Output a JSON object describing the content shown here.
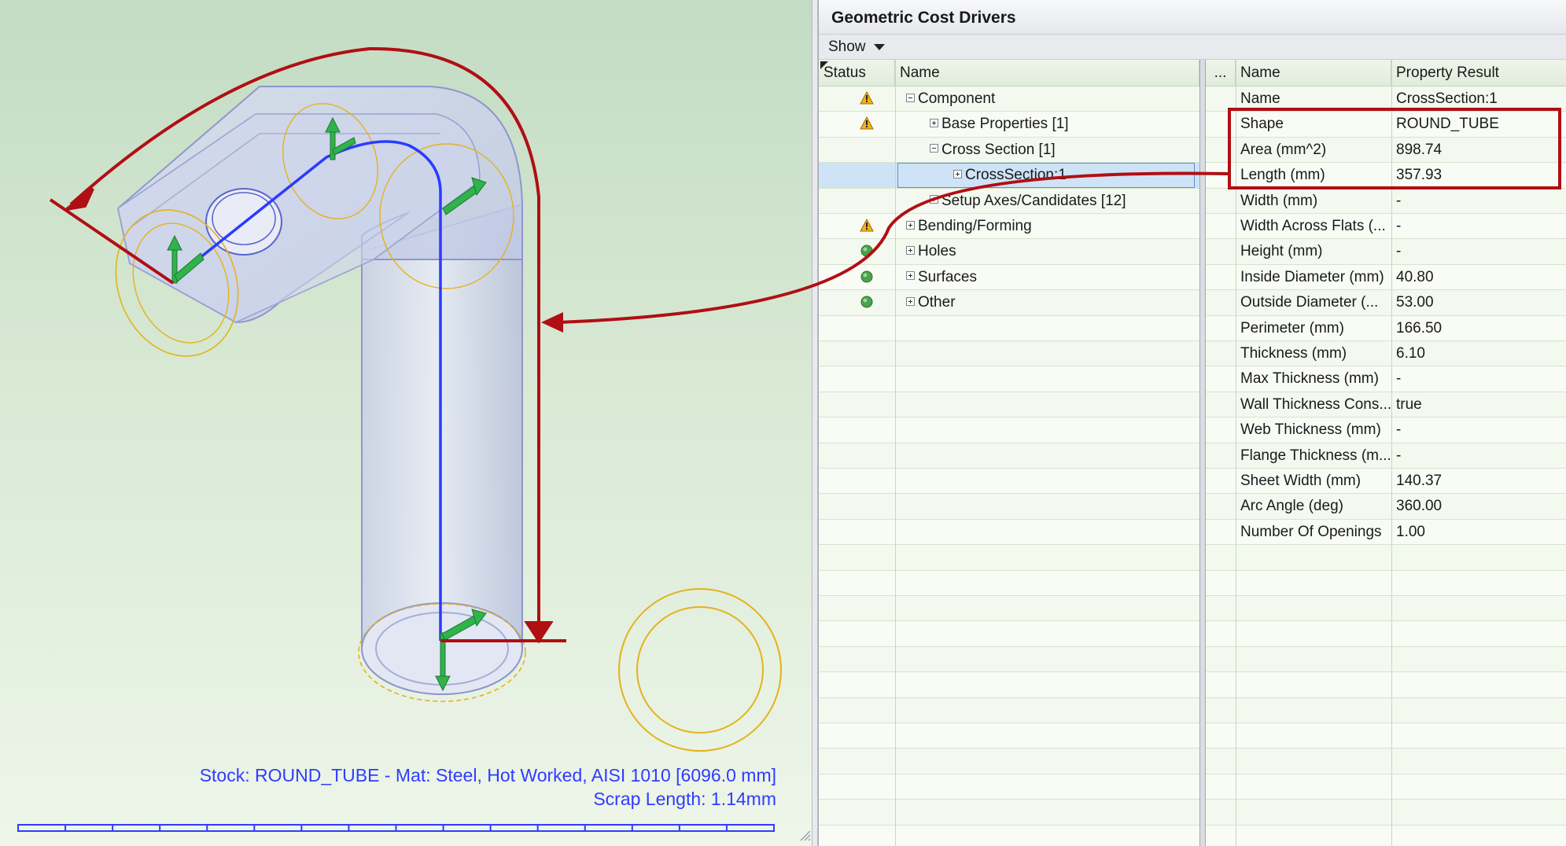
{
  "viewport": {
    "stock_text": "Stock: ROUND_TUBE  -  Mat: Steel, Hot Worked, AISI 1010 [6096.0 mm]",
    "scrap_text": "Scrap Length: 1.14mm"
  },
  "panel": {
    "title": "Geometric Cost Drivers",
    "show_label": "Show"
  },
  "tree": {
    "columns": {
      "status": "Status",
      "name": "Name"
    },
    "rows": [
      {
        "status": "warning",
        "label": "Component",
        "expander": "minus",
        "level": 0
      },
      {
        "status": "warning",
        "label": "Base Properties [1]",
        "expander": "plus",
        "level": 1
      },
      {
        "status": "",
        "label": "Cross Section [1]",
        "expander": "minus",
        "level": 1
      },
      {
        "status": "",
        "label": "CrossSection:1",
        "expander": "plus",
        "level": 2,
        "selected": true
      },
      {
        "status": "",
        "label": "Setup Axes/Candidates [12]",
        "expander": "plus",
        "level": 1
      },
      {
        "status": "warning",
        "label": "Bending/Forming",
        "expander": "plus",
        "level": 0
      },
      {
        "status": "ok",
        "label": "Holes",
        "expander": "plus",
        "level": 0
      },
      {
        "status": "ok",
        "label": "Surfaces",
        "expander": "plus",
        "level": 0
      },
      {
        "status": "ok",
        "label": "Other",
        "expander": "plus",
        "level": 0
      }
    ]
  },
  "properties": {
    "columns": {
      "dots": "...",
      "name": "Name",
      "result": "Property Result"
    },
    "rows": [
      {
        "name": "Name",
        "value": "CrossSection:1"
      },
      {
        "name": "Shape",
        "value": "ROUND_TUBE"
      },
      {
        "name": "Area (mm^2)",
        "value": "898.74"
      },
      {
        "name": "Length (mm)",
        "value": "357.93"
      },
      {
        "name": "Width (mm)",
        "value": "-"
      },
      {
        "name": "Width Across Flats (...",
        "value": "-"
      },
      {
        "name": "Height (mm)",
        "value": "-"
      },
      {
        "name": "Inside Diameter (mm)",
        "value": "40.80"
      },
      {
        "name": "Outside Diameter (...",
        "value": "53.00"
      },
      {
        "name": "Perimeter (mm)",
        "value": "166.50"
      },
      {
        "name": "Thickness (mm)",
        "value": "6.10"
      },
      {
        "name": "Max Thickness (mm)",
        "value": "-"
      },
      {
        "name": "Wall Thickness Cons...",
        "value": "true"
      },
      {
        "name": "Web Thickness (mm)",
        "value": "-"
      },
      {
        "name": "Flange Thickness (m...",
        "value": "-"
      },
      {
        "name": "Sheet Width (mm)",
        "value": "140.37"
      },
      {
        "name": "Arc Angle (deg)",
        "value": "360.00"
      },
      {
        "name": "Number Of Openings",
        "value": "1.00"
      }
    ]
  },
  "colors": {
    "annotation": "#b00f14",
    "axis_blue": "#2b3bff",
    "edge_orange": "#e5b21c",
    "status_ok": "#4aa34a",
    "status_warning": "#f3b21e"
  }
}
